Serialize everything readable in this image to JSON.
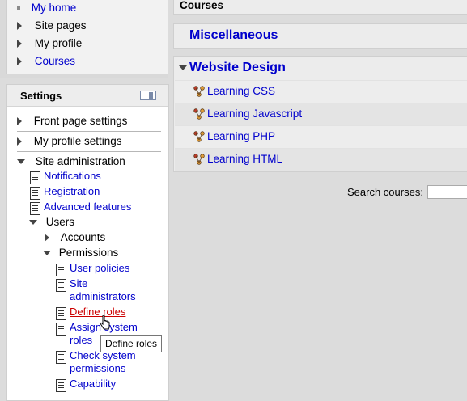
{
  "navigation": {
    "items": [
      {
        "label": "My home",
        "marker": "bullet",
        "link": true
      },
      {
        "label": "Site pages",
        "marker": "collapsed",
        "link": false
      },
      {
        "label": "My profile",
        "marker": "collapsed",
        "link": false
      },
      {
        "label": "Courses",
        "marker": "collapsed",
        "link": true
      }
    ]
  },
  "settings": {
    "title": "Settings",
    "front_page": "Front page settings",
    "my_profile": "My profile settings",
    "site_admin": "Site administration",
    "notifications": "Notifications",
    "registration": "Registration",
    "advanced_features": "Advanced features",
    "users": "Users",
    "accounts": "Accounts",
    "permissions": "Permissions",
    "user_policies": "User policies",
    "site_administrators_1": "Site",
    "site_administrators_2": "administrators",
    "define_roles": "Define roles",
    "assign_roles_1": "Assign system",
    "assign_roles_2": "roles",
    "check_permissions_1": "Check system",
    "check_permissions_2": "permissions",
    "capability_1": "Capability"
  },
  "tooltip": "Define roles",
  "courses": {
    "title": "Courses",
    "categories": [
      {
        "name": "Miscellaneous",
        "expanded": false
      },
      {
        "name": "Website Design",
        "expanded": true,
        "courses": [
          "Learning CSS",
          "Learning Javascript",
          "Learning PHP",
          "Learning HTML"
        ]
      }
    ],
    "search_label": "Search courses:",
    "search_value": ""
  },
  "colors": {
    "link": "#0000cc",
    "hover_link": "#cc0000",
    "panel_bg": "#ececec",
    "page_bg": "#dcdcdc"
  }
}
